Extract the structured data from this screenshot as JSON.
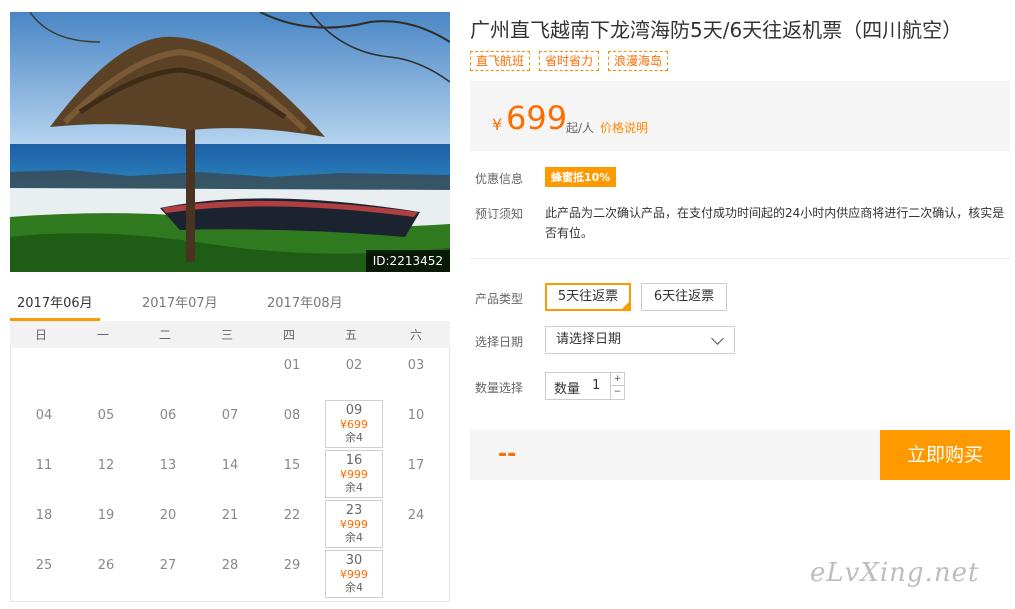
{
  "photo": {
    "id_label": "ID:2213452"
  },
  "product": {
    "title": "广州直飞越南下龙湾海防5天/6天往返机票（四川航空）",
    "tags": [
      "直飞航班",
      "省时省力",
      "浪漫海岛"
    ]
  },
  "price": {
    "currency": "¥",
    "amount": "699",
    "unit": "起/人",
    "explain_link": "价格说明"
  },
  "promo": {
    "label": "优惠信息",
    "badge": "蜂蜜抵10%"
  },
  "notice": {
    "label": "预订须知",
    "text": "此产品为二次确认产品，在支付成功时间起的24小时内供应商将进行二次确认，核实是否有位。"
  },
  "product_type": {
    "label": "产品类型",
    "options": [
      "5天往返票",
      "6天往返票"
    ],
    "selected": "5天往返票"
  },
  "date_select": {
    "label": "选择日期",
    "value": "请选择日期"
  },
  "quantity": {
    "label": "数量选择",
    "field_label": "数量",
    "value": "1",
    "up": "+",
    "down": "−"
  },
  "total": {
    "value": "--"
  },
  "buy_button": {
    "label": "立即购买"
  },
  "calendar": {
    "months": [
      "2017年06月",
      "2017年07月",
      "2017年08月"
    ],
    "active_month": "2017年06月",
    "weekdays": [
      "日",
      "一",
      "二",
      "三",
      "四",
      "五",
      "六"
    ],
    "days": [
      {
        "d": "01"
      },
      {
        "d": "02"
      },
      {
        "d": "03"
      },
      {
        "d": "04"
      },
      {
        "d": "05"
      },
      {
        "d": "06"
      },
      {
        "d": "07"
      },
      {
        "d": "08"
      },
      {
        "d": "09",
        "price": "¥699",
        "left": "余4"
      },
      {
        "d": "10"
      },
      {
        "d": "11"
      },
      {
        "d": "12"
      },
      {
        "d": "13"
      },
      {
        "d": "14"
      },
      {
        "d": "15"
      },
      {
        "d": "16",
        "price": "¥999",
        "left": "余4"
      },
      {
        "d": "17"
      },
      {
        "d": "18"
      },
      {
        "d": "19"
      },
      {
        "d": "20"
      },
      {
        "d": "21"
      },
      {
        "d": "22"
      },
      {
        "d": "23",
        "price": "¥999",
        "left": "余4"
      },
      {
        "d": "24"
      },
      {
        "d": "25"
      },
      {
        "d": "26"
      },
      {
        "d": "27"
      },
      {
        "d": "28"
      },
      {
        "d": "29"
      },
      {
        "d": "30",
        "price": "¥999",
        "left": "余4"
      }
    ],
    "first_weekday": 4
  },
  "watermark": "eLvXing.net",
  "colors": {
    "accent": "#ff9900",
    "price": "#ff6d00"
  }
}
